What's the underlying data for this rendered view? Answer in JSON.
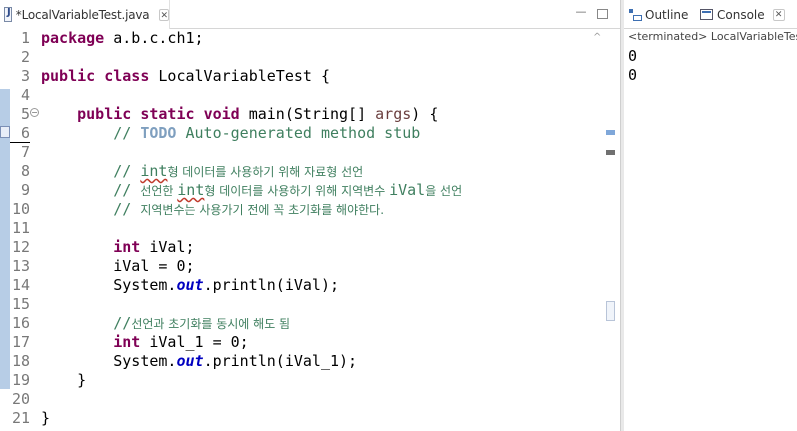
{
  "editor": {
    "tab_title": "*LocalVariableTest.java",
    "tab_close": "✕",
    "minimize": "▭",
    "maximize": ""
  },
  "code_lines": [
    {
      "n": "1"
    },
    {
      "n": "2"
    },
    {
      "n": "3"
    },
    {
      "n": "4"
    },
    {
      "n": "5"
    },
    {
      "n": "6"
    },
    {
      "n": "7"
    },
    {
      "n": "8"
    },
    {
      "n": "9"
    },
    {
      "n": "10"
    },
    {
      "n": "11"
    },
    {
      "n": "12"
    },
    {
      "n": "13"
    },
    {
      "n": "14"
    },
    {
      "n": "15"
    },
    {
      "n": "16"
    },
    {
      "n": "17"
    },
    {
      "n": "18"
    },
    {
      "n": "19"
    },
    {
      "n": "20"
    },
    {
      "n": "21"
    }
  ],
  "code": {
    "l1_kw": "package",
    "l1_rest": " a.b.c.ch1;",
    "l3_kw1": "public",
    "l3_kw2": "class",
    "l3_rest": " LocalVariableTest {",
    "l5_kw1": "public",
    "l5_kw2": "static",
    "l5_kw3": "void",
    "l5_rest": " main(String[] ",
    "l5_args": "args",
    "l5_end": ") {",
    "l6_pre": "// ",
    "l6_todo": "TODO",
    "l6_rest": " Auto-generated method stub",
    "l8_pre": "// ",
    "l8_int": "int",
    "l8_rest": "형 데이터를 사용하기 위해 자료형 선언",
    "l9_pre": "// ",
    "l9_a": "선언한 ",
    "l9_int": "int",
    "l9_b": "형 데이터를 사용하기 위해 지역변수 ",
    "l9_ival": "iVal",
    "l9_c": "을 선언",
    "l10_pre": "// ",
    "l10_rest": "지역변수는 사용가기 전에 꼭 초기화를 해야한다.",
    "l12_kw": "int",
    "l12_rest": " iVal;",
    "l13_rest": "iVal = 0;",
    "l14_a": "System.",
    "l14_out": "out",
    "l14_b": ".println(iVal);",
    "l16_pre": "//",
    "l16_rest": "선언과 초기화를 동시에 해도 됨",
    "l17_kw": "int",
    "l17_rest": " iVal_1 = 0;",
    "l18_a": "System.",
    "l18_out": "out",
    "l18_b": ".println(iVal_1);",
    "l19": "}",
    "l21": "}"
  },
  "console": {
    "tab_outline": "Outline",
    "tab_console": "Console",
    "tab_close": "✕",
    "status": "<terminated> LocalVariableTest",
    "output": [
      "0",
      "0"
    ]
  },
  "icons": {
    "file": "java-file-icon",
    "outline": "outline-icon",
    "console": "console-icon"
  }
}
